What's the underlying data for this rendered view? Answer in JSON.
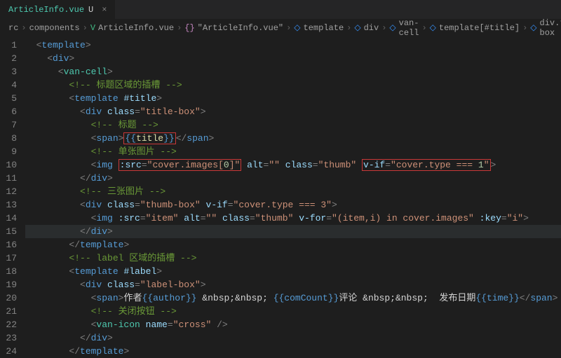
{
  "tab": {
    "filename": "ArticleInfo.vue",
    "status": "U"
  },
  "breadcrumbs": {
    "b0": "rc",
    "b1": "components",
    "b2": "ArticleInfo.vue",
    "b3": "\"ArticleInfo.vue\"",
    "b4": "template",
    "b5": "div",
    "b6": "van-cell",
    "b7": "template[#title]",
    "b8": "div.thumb-box"
  },
  "gutter": {
    "l1": "1",
    "l2": "2",
    "l3": "3",
    "l4": "4",
    "l5": "5",
    "l6": "6",
    "l7": "7",
    "l8": "8",
    "l9": "9",
    "l10": "10",
    "l11": "11",
    "l12": "12",
    "l13": "13",
    "l14": "14",
    "l15": "15",
    "l16": "16",
    "l17": "17",
    "l18": "18",
    "l19": "19",
    "l20": "20",
    "l21": "21",
    "l22": "22",
    "l23": "23",
    "l24": "24"
  },
  "code": {
    "tag_template": "template",
    "tag_div": "div",
    "tag_vancell": "van-cell",
    "tag_img": "img",
    "tag_span": "span",
    "tag_vanicon": "van-icon",
    "cm4": "<!-- 标题区域的插槽 -->",
    "cm7": "<!-- 标题 -->",
    "cm9": "<!-- 单张图片 -->",
    "cm12": "<!-- 三张图片 -->",
    "cm17": "<!-- label 区域的插槽 -->",
    "cm21": "<!-- 关闭按钮 -->",
    "attr_title": "#title",
    "attr_label": "#label",
    "attr_class": "class",
    "attr_src": ":src",
    "attr_alt": "alt",
    "attr_vif": "v-if",
    "attr_vfor": "v-for",
    "attr_key": ":key",
    "attr_name": "name",
    "val_titlebox": "\"title-box\"",
    "val_thumb": "\"thumb\"",
    "val_thumbbox": "\"thumb-box\"",
    "val_labelbox": "\"label-box\"",
    "val_coverimages0_pre": "\"cover.images[",
    "val_coverimages0_num": "0",
    "val_coverimages0_post": "]\"",
    "val_covertype1_pre": "\"cover.type === ",
    "val_covertype1_num": "1",
    "val_covertype1_post": "\"",
    "val_covertype3": "\"cover.type === 3\"",
    "val_item": "\"item\"",
    "val_forloop": "\"(item,i) in cover.images\"",
    "val_key_i": "\"i\"",
    "val_empty": "\"\"",
    "val_cross": "\"cross\"",
    "bind_title_open": "{{",
    "bind_title_mid": "title",
    "bind_title_close": "}}",
    "line20_author_label": "作者",
    "line20_author_bind": "{{author}}",
    "line20_nbsp": " &nbsp;&nbsp; ",
    "line20_comcount_bind": "{{comCount}}",
    "line20_comcount_label": "评论",
    "line20_date_label": " 发布日期",
    "line20_time_bind": "{{time}}"
  }
}
